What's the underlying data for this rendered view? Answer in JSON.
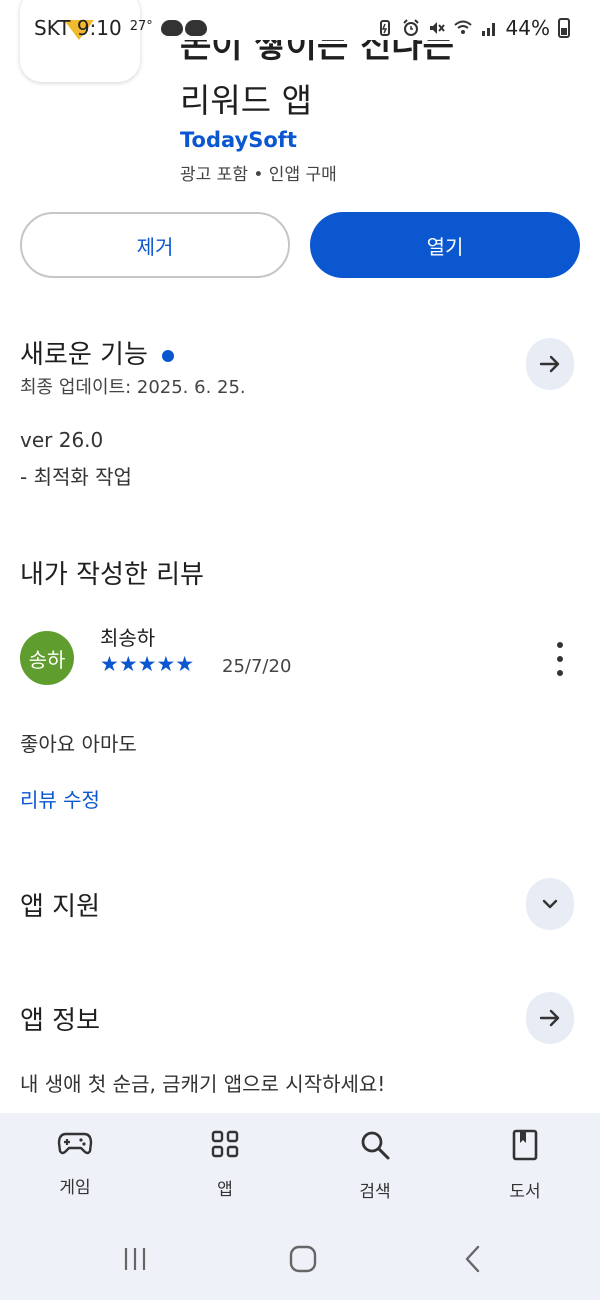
{
  "status_bar": {
    "carrier_time": "SKT 9:10",
    "temperature": "27°",
    "battery": "44%"
  },
  "app": {
    "title_line1": "돈이 쌓이는 신나는",
    "title_line2": "리워드 앱",
    "developer": "TodaySoft",
    "meta": "광고 포함 • 인앱 구매"
  },
  "buttons": {
    "remove": "제거",
    "open": "열기"
  },
  "whats_new": {
    "title": "새로운 기능",
    "last_updated": "최종 업데이트: 2025. 6. 25.",
    "version": "ver 26.0",
    "note": "- 최적화 작업"
  },
  "my_review": {
    "title": "내가 작성한 리뷰",
    "avatar_text": "송하",
    "avatar_color": "#5f9d2f",
    "reviewer": "최송하",
    "rating": 5,
    "stars": "★★★★★",
    "date": "25/7/20",
    "text": "좋아요 아마도",
    "edit": "리뷰 수정"
  },
  "app_support": {
    "title": "앱 지원"
  },
  "app_info": {
    "title": "앱 정보",
    "description": "내 생애 첫 순금, 금캐기 앱으로 시작하세요!"
  },
  "bottom_nav": [
    {
      "label": "게임",
      "icon": "gamepad-icon"
    },
    {
      "label": "앱",
      "icon": "apps-grid-icon"
    },
    {
      "label": "검색",
      "icon": "search-icon"
    },
    {
      "label": "도서",
      "icon": "book-icon"
    }
  ],
  "colors": {
    "accent": "#0b57d0",
    "nav_bg": "#eef1f7",
    "round_button_bg": "#e8edf5"
  }
}
